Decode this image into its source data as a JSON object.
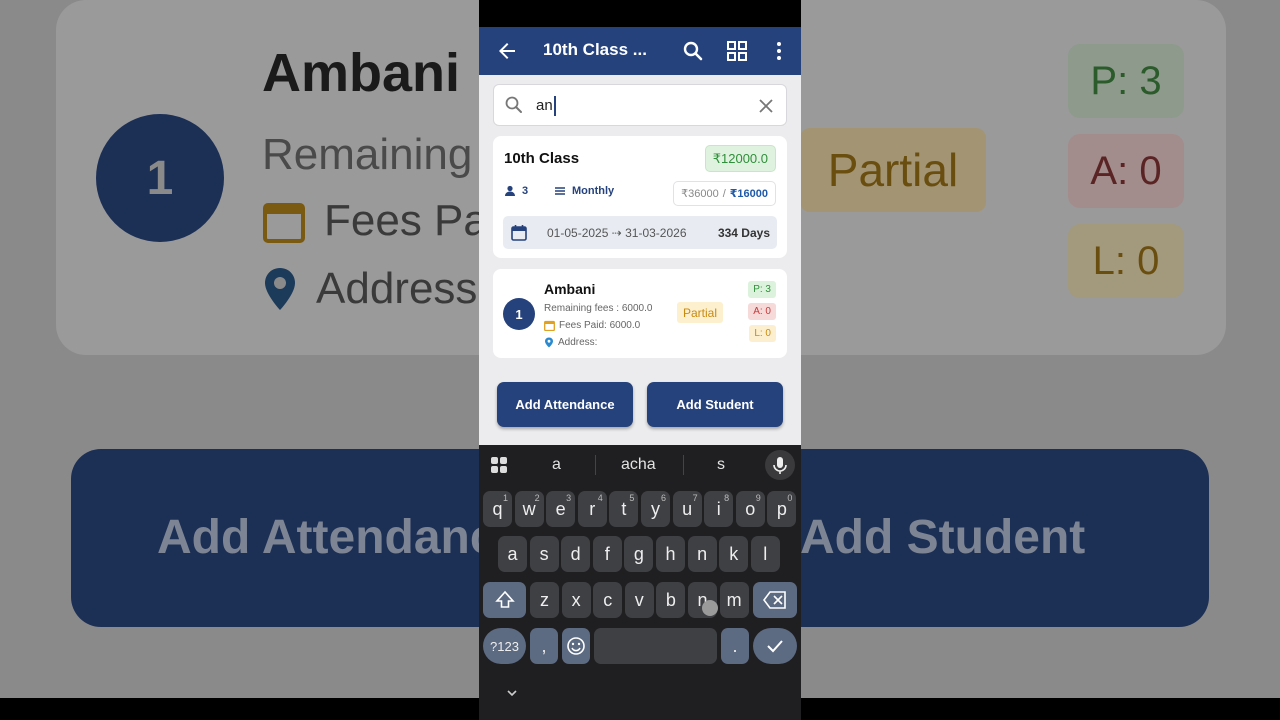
{
  "background": {
    "student_number": "1",
    "student_name": "Ambani",
    "remaining": "Remaining",
    "fees_paid": "Fees Pa",
    "address": "Address",
    "partial": "Partial",
    "present": "P: 3",
    "absent": "A: 0",
    "leave": "L: 0",
    "btn_attendance": "Add Attendance",
    "btn_student": "Add Student"
  },
  "appbar": {
    "title": "10th Class ...",
    "color": "#25427c"
  },
  "search": {
    "value": "an",
    "placeholder": ""
  },
  "class_card": {
    "name": "10th Class",
    "amount": "₹12000.0",
    "students": "3",
    "frequency": "Monthly",
    "total_fee": "₹36000",
    "separator": "/",
    "collected_fee": "₹16000",
    "date_range": "01-05-2025 ⇢ 31-03-2026",
    "days": "334 Days"
  },
  "student": {
    "number": "1",
    "name": "Ambani",
    "remaining": "Remaining fees : 6000.0",
    "fees_paid": "Fees Paid: 6000.0",
    "address": "Address:",
    "status": "Partial",
    "present": "P: 3",
    "absent": "A: 0",
    "leave": "L: 0"
  },
  "actions": {
    "add_attendance": "Add Attendance",
    "add_student": "Add Student"
  },
  "keyboard": {
    "suggestions": [
      "a",
      "acha",
      "s"
    ],
    "row1": [
      "q",
      "w",
      "e",
      "r",
      "t",
      "y",
      "u",
      "i",
      "o",
      "p"
    ],
    "row1_hints": [
      "1",
      "2",
      "3",
      "4",
      "5",
      "6",
      "7",
      "8",
      "9",
      "0"
    ],
    "row2": [
      "a",
      "s",
      "d",
      "f",
      "g",
      "h",
      "n",
      "k",
      "l"
    ],
    "row3": [
      "z",
      "x",
      "c",
      "v",
      "b",
      "n",
      "m"
    ],
    "sym_key": "?123",
    "comma": ",",
    "period": "."
  }
}
